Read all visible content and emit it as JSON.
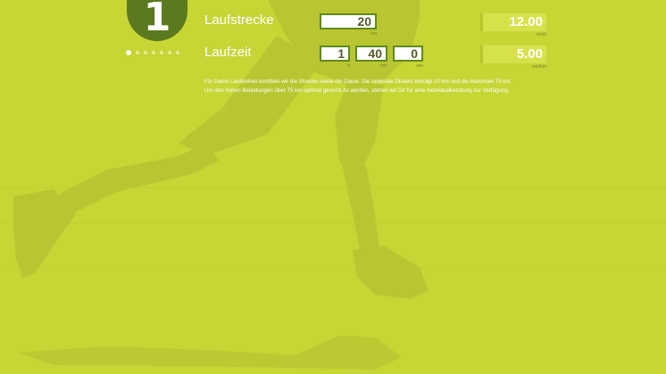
{
  "step": {
    "number": "1",
    "dots": [
      1,
      2,
      3,
      4,
      5,
      6,
      7
    ],
    "active_index": 0
  },
  "distance": {
    "label": "Laufstrecke",
    "value": "20",
    "unit": "km"
  },
  "duration": {
    "label": "Laufzeit",
    "hours": "1",
    "hours_unit": "h",
    "minutes": "40",
    "minutes_unit": "min",
    "seconds": "0",
    "seconds_unit": "sek"
  },
  "results": {
    "speed_value": "12.00",
    "speed_unit": "km/h",
    "pace_value": "5.00",
    "pace_unit": "min/km"
  },
  "description": {
    "line1": "Für Deine Laufeinheit ermitteln wir die Strecke sowie die Dauer. Die minimale Distanz beträgt 10 km und die maximale 75 km.",
    "line2": "Um den hohen Belastungen über 75 km optimal gerecht zu werden, stehen wir Dir für eine Individualberatung zur Verfügung."
  },
  "colors": {
    "background": "#c7d535",
    "accent_dark": "#5b7a1f",
    "field_border": "#5f8a1c",
    "result_bg": "#d7e24b"
  }
}
